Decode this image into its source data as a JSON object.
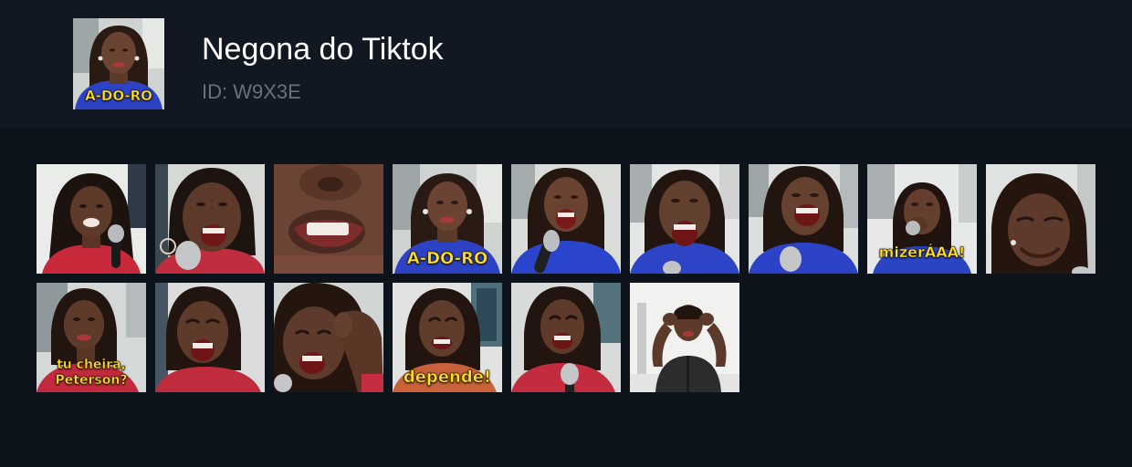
{
  "pack": {
    "title": "Negona do Tiktok",
    "id_label": "ID: W9X3E",
    "thumbnail_caption": "A-DO-RO"
  },
  "stickers": [
    {
      "caption": "",
      "scene": "red-top-mic-light-room"
    },
    {
      "caption": "",
      "scene": "red-top-laughing-mic"
    },
    {
      "caption": "",
      "scene": "close-up-mouth"
    },
    {
      "caption": "A-DO-RO",
      "scene": "blue-top-mic"
    },
    {
      "caption": "",
      "scene": "blue-top-singing-mic"
    },
    {
      "caption": "",
      "scene": "blue-top-laughing"
    },
    {
      "caption": "",
      "scene": "blue-top-laughing-mic"
    },
    {
      "caption": "mizerÁAA!",
      "scene": "blue-top-hand-mouth"
    },
    {
      "caption": "",
      "scene": "close-up-laughing"
    },
    {
      "caption": "tu cheira,\nPeterson?",
      "scene": "red-top-portrait"
    },
    {
      "caption": "",
      "scene": "red-top-laughing"
    },
    {
      "caption": "",
      "scene": "hand-on-head-laughing"
    },
    {
      "caption": "depende!",
      "scene": "red-top-smiling"
    },
    {
      "caption": "",
      "scene": "red-top-mic-laughing"
    },
    {
      "caption": "",
      "scene": "black-top-hands-on-head"
    }
  ],
  "colors": {
    "header_bg": "#111821",
    "page_bg": "#0d131b",
    "title_text": "#ffffff",
    "id_text": "#6b7079",
    "caption_text": "#ffe02a"
  }
}
